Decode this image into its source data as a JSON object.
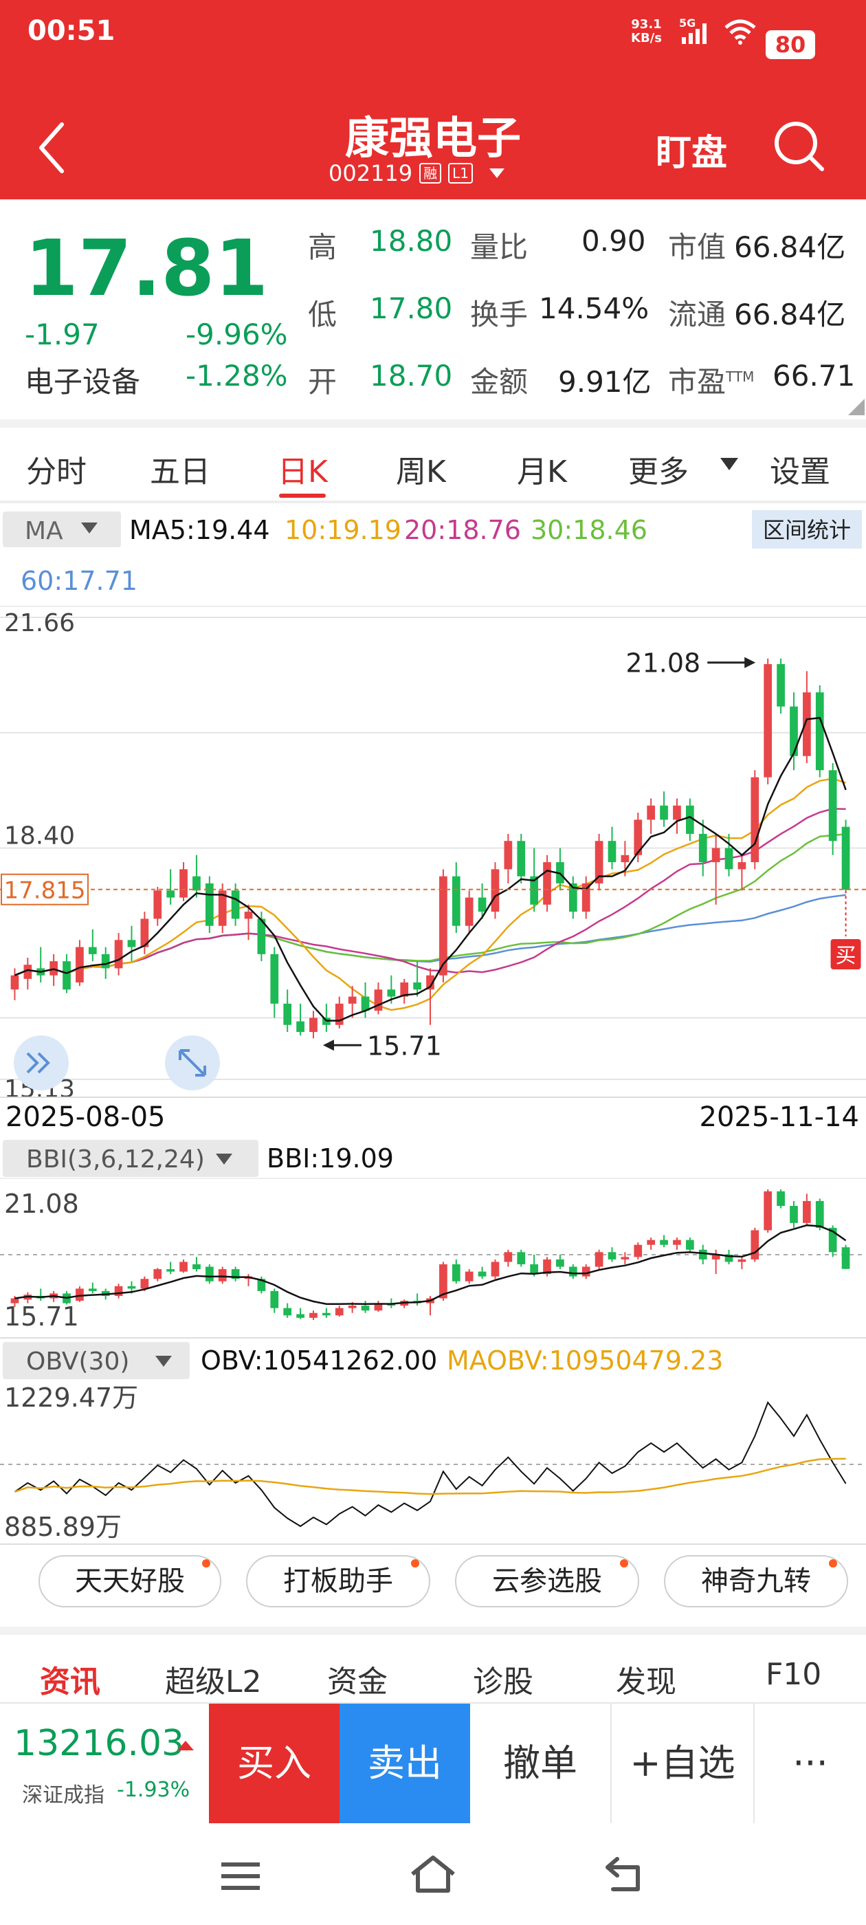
{
  "status_bar": {
    "time": "00:51",
    "net_speed": "93.1",
    "net_unit": "KB/s",
    "signal_label": "5G",
    "battery": "80"
  },
  "header": {
    "title": "康强电子",
    "code": "002119",
    "badge_rong": "融",
    "badge_level": "L1",
    "watch_label": "盯盘"
  },
  "quote": {
    "price": "17.81",
    "change": "-1.97",
    "change_pct": "-9.96%",
    "sector": "电子设备",
    "sector_pct": "-1.28%",
    "rows": [
      {
        "l1": "高",
        "v1": "18.80",
        "l2": "量比",
        "v2": "0.90",
        "l3": "市值",
        "v3": "66.84亿"
      },
      {
        "l1": "低",
        "v1": "17.80",
        "l2": "换手",
        "v2": "14.54%",
        "l3": "流通",
        "v3": "66.84亿"
      },
      {
        "l1": "开",
        "v1": "18.70",
        "l2": "金额",
        "v2": "9.91亿",
        "l3": "市盈",
        "v3": "66.71"
      }
    ],
    "pe_sup": "TTM"
  },
  "tabs": [
    "分时",
    "五日",
    "日K",
    "周K",
    "月K",
    "更多",
    "设置"
  ],
  "active_tab": "日K",
  "ma": {
    "selector": "MA",
    "ma5": "MA5:19.44",
    "ma10": "10:19.19",
    "ma20": "20:18.76",
    "ma30": "30:18.46",
    "ma60": "60:17.71",
    "range_stats": "区间统计"
  },
  "main_chart": {
    "y_top": "21.66",
    "y_mid": "18.40",
    "y_bottom": "15.13",
    "current_label": "17.815",
    "max_label": "21.08",
    "min_label": "15.71",
    "date_start": "2025-08-05",
    "date_end": "2025-11-14",
    "buy_marker": "买"
  },
  "bbi": {
    "selector": "BBI(3,6,12,24)",
    "value": "BBI:19.09",
    "y_top": "21.08",
    "y_bottom": "15.71"
  },
  "obv": {
    "selector": "OBV(30)",
    "value": "OBV:10541262.00",
    "maobv": "MAOBV:10950479.23",
    "y_top": "1229.47万",
    "y_bottom": "885.89万"
  },
  "tools": [
    "天天好股",
    "打板助手",
    "云参选股",
    "神奇九转"
  ],
  "bottom_tabs": [
    "资讯",
    "超级L2",
    "资金",
    "诊股",
    "发现",
    "F10"
  ],
  "index": {
    "value": "13216.03",
    "name": "深证成指",
    "pct": "-1.93%"
  },
  "actions": {
    "buy": "买入",
    "sell": "卖出",
    "cancel": "撤单",
    "add_watch": "+自选",
    "more": "···"
  },
  "colors": {
    "up": "#e8474a",
    "down": "#1db954",
    "header": "#e62e2e",
    "ma5": "#111111",
    "ma10": "#e8a50f",
    "ma20": "#c43a8e",
    "ma30": "#6bbf3a",
    "ma60": "#5b8fd6"
  },
  "chart_data": {
    "type": "candlestick",
    "x_range": [
      "2025-08-05",
      "2025-11-14"
    ],
    "ylim": [
      15.13,
      21.66
    ],
    "candles": [
      {
        "o": 16.4,
        "h": 16.7,
        "l": 16.25,
        "c": 16.6
      },
      {
        "o": 16.55,
        "h": 16.85,
        "l": 16.4,
        "c": 16.75
      },
      {
        "o": 16.7,
        "h": 17.0,
        "l": 16.5,
        "c": 16.6
      },
      {
        "o": 16.6,
        "h": 16.9,
        "l": 16.45,
        "c": 16.8
      },
      {
        "o": 16.8,
        "h": 16.9,
        "l": 16.35,
        "c": 16.4
      },
      {
        "o": 16.5,
        "h": 17.1,
        "l": 16.45,
        "c": 17.0
      },
      {
        "o": 17.0,
        "h": 17.25,
        "l": 16.8,
        "c": 16.9
      },
      {
        "o": 16.9,
        "h": 17.0,
        "l": 16.55,
        "c": 16.7
      },
      {
        "o": 16.7,
        "h": 17.2,
        "l": 16.6,
        "c": 17.1
      },
      {
        "o": 17.1,
        "h": 17.3,
        "l": 16.8,
        "c": 17.0
      },
      {
        "o": 17.0,
        "h": 17.5,
        "l": 16.9,
        "c": 17.4
      },
      {
        "o": 17.4,
        "h": 17.85,
        "l": 17.3,
        "c": 17.8
      },
      {
        "o": 17.8,
        "h": 18.1,
        "l": 17.6,
        "c": 17.7
      },
      {
        "o": 17.7,
        "h": 18.2,
        "l": 17.65,
        "c": 18.1
      },
      {
        "o": 18.0,
        "h": 18.3,
        "l": 17.7,
        "c": 17.8
      },
      {
        "o": 17.9,
        "h": 18.0,
        "l": 17.2,
        "c": 17.3
      },
      {
        "o": 17.3,
        "h": 17.9,
        "l": 17.2,
        "c": 17.8
      },
      {
        "o": 17.8,
        "h": 17.9,
        "l": 17.3,
        "c": 17.4
      },
      {
        "o": 17.4,
        "h": 17.6,
        "l": 17.1,
        "c": 17.5
      },
      {
        "o": 17.4,
        "h": 17.5,
        "l": 16.8,
        "c": 16.9
      },
      {
        "o": 16.9,
        "h": 17.0,
        "l": 16.0,
        "c": 16.2
      },
      {
        "o": 16.2,
        "h": 16.4,
        "l": 15.8,
        "c": 15.9
      },
      {
        "o": 15.95,
        "h": 16.2,
        "l": 15.75,
        "c": 15.8
      },
      {
        "o": 15.8,
        "h": 16.1,
        "l": 15.71,
        "c": 16.0
      },
      {
        "o": 16.0,
        "h": 16.2,
        "l": 15.8,
        "c": 15.9
      },
      {
        "o": 15.9,
        "h": 16.3,
        "l": 15.85,
        "c": 16.2
      },
      {
        "o": 16.2,
        "h": 16.45,
        "l": 16.0,
        "c": 16.3
      },
      {
        "o": 16.3,
        "h": 16.5,
        "l": 16.0,
        "c": 16.1
      },
      {
        "o": 16.1,
        "h": 16.5,
        "l": 16.05,
        "c": 16.4
      },
      {
        "o": 16.4,
        "h": 16.6,
        "l": 16.2,
        "c": 16.3
      },
      {
        "o": 16.3,
        "h": 16.55,
        "l": 16.2,
        "c": 16.5
      },
      {
        "o": 16.5,
        "h": 16.8,
        "l": 16.3,
        "c": 16.4
      },
      {
        "o": 16.4,
        "h": 16.7,
        "l": 15.9,
        "c": 16.6
      },
      {
        "o": 16.6,
        "h": 18.1,
        "l": 16.5,
        "c": 18.0
      },
      {
        "o": 18.0,
        "h": 18.2,
        "l": 17.2,
        "c": 17.3
      },
      {
        "o": 17.3,
        "h": 17.8,
        "l": 17.2,
        "c": 17.7
      },
      {
        "o": 17.7,
        "h": 17.9,
        "l": 17.4,
        "c": 17.5
      },
      {
        "o": 17.5,
        "h": 18.2,
        "l": 17.4,
        "c": 18.1
      },
      {
        "o": 18.1,
        "h": 18.6,
        "l": 17.9,
        "c": 18.5
      },
      {
        "o": 18.5,
        "h": 18.6,
        "l": 17.9,
        "c": 18.0
      },
      {
        "o": 18.0,
        "h": 18.4,
        "l": 17.5,
        "c": 17.6
      },
      {
        "o": 17.6,
        "h": 18.3,
        "l": 17.5,
        "c": 18.2
      },
      {
        "o": 18.2,
        "h": 18.4,
        "l": 17.8,
        "c": 17.9
      },
      {
        "o": 17.9,
        "h": 18.0,
        "l": 17.4,
        "c": 17.5
      },
      {
        "o": 17.5,
        "h": 18.0,
        "l": 17.4,
        "c": 17.9
      },
      {
        "o": 17.9,
        "h": 18.6,
        "l": 17.8,
        "c": 18.5
      },
      {
        "o": 18.5,
        "h": 18.7,
        "l": 18.1,
        "c": 18.2
      },
      {
        "o": 18.2,
        "h": 18.5,
        "l": 18.0,
        "c": 18.3
      },
      {
        "o": 18.3,
        "h": 18.9,
        "l": 18.2,
        "c": 18.8
      },
      {
        "o": 18.8,
        "h": 19.1,
        "l": 18.6,
        "c": 19.0
      },
      {
        "o": 19.0,
        "h": 19.2,
        "l": 18.7,
        "c": 18.8
      },
      {
        "o": 18.8,
        "h": 19.1,
        "l": 18.6,
        "c": 19.0
      },
      {
        "o": 19.0,
        "h": 19.1,
        "l": 18.5,
        "c": 18.6
      },
      {
        "o": 18.6,
        "h": 18.8,
        "l": 18.0,
        "c": 18.2
      },
      {
        "o": 18.2,
        "h": 18.6,
        "l": 17.6,
        "c": 18.4
      },
      {
        "o": 18.4,
        "h": 18.6,
        "l": 18.0,
        "c": 18.1
      },
      {
        "o": 18.1,
        "h": 18.3,
        "l": 17.8,
        "c": 18.2
      },
      {
        "o": 18.2,
        "h": 19.5,
        "l": 18.1,
        "c": 19.4
      },
      {
        "o": 19.4,
        "h": 21.08,
        "l": 19.3,
        "c": 21.0
      },
      {
        "o": 21.0,
        "h": 21.08,
        "l": 20.3,
        "c": 20.4
      },
      {
        "o": 20.4,
        "h": 20.6,
        "l": 19.5,
        "c": 19.7
      },
      {
        "o": 19.7,
        "h": 20.9,
        "l": 19.6,
        "c": 20.6
      },
      {
        "o": 20.6,
        "h": 20.7,
        "l": 19.4,
        "c": 19.5
      },
      {
        "o": 19.5,
        "h": 19.6,
        "l": 18.3,
        "c": 18.5
      },
      {
        "o": 18.7,
        "h": 18.8,
        "l": 17.8,
        "c": 17.81
      }
    ],
    "min_point": 15.71,
    "max_point": 21.08,
    "current_price": 17.815
  }
}
